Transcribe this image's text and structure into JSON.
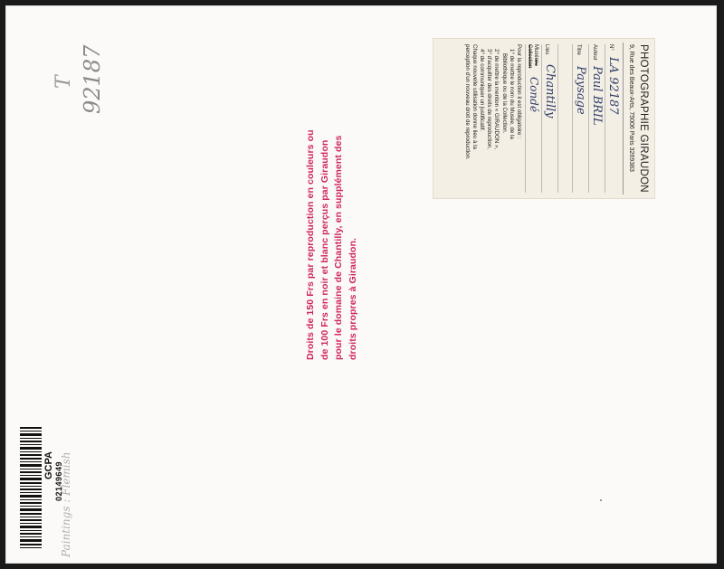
{
  "pencil_notes": {
    "t_mark": "T",
    "catalog_number": "92187",
    "category": "Paintings : Flemish"
  },
  "stamp": {
    "lines": [
      "Droits de 150 Frs par reproduction en couleurs ou",
      "de 100 Frs en noir et blanc perçus par Giraudon",
      "pour le domaine de Chantilly, en supplément des",
      "droits propres à Giraudon."
    ],
    "color": "#d0245a"
  },
  "label": {
    "company": "PHOTOGRAPHIE GIRAUDON",
    "address": "9, Rue des Beaux-Arts, 75006 Paris 3269383",
    "fields": [
      {
        "key": "N°",
        "value": "LA 92187"
      },
      {
        "key": "Auteur",
        "value": "Paul BRIL"
      },
      {
        "key": "Titre",
        "value": "Paysage"
      },
      {
        "key": "Lieu",
        "value": "Chantilly"
      },
      {
        "key": "Musée",
        "value": "Condé"
      }
    ],
    "collection_struck": "Collection",
    "musee_struck": "ou",
    "notice": [
      "Pour la reproduction il est obligatoire :",
      "1° de mettre le nom du Musée, de la",
      "Bibliothèque ou de la Collection.",
      "2° de mettre la mention « GIRAUDON »,",
      "3° d'acquitter des droits de reproduction,",
      "4° de communiquer un justificatif.",
      "Chaque nouvelle utilisation donne lieu à la",
      "perception d'un nouveau droit de reproduction."
    ]
  },
  "barcode": {
    "org": "GCPA",
    "number": "02149649"
  }
}
